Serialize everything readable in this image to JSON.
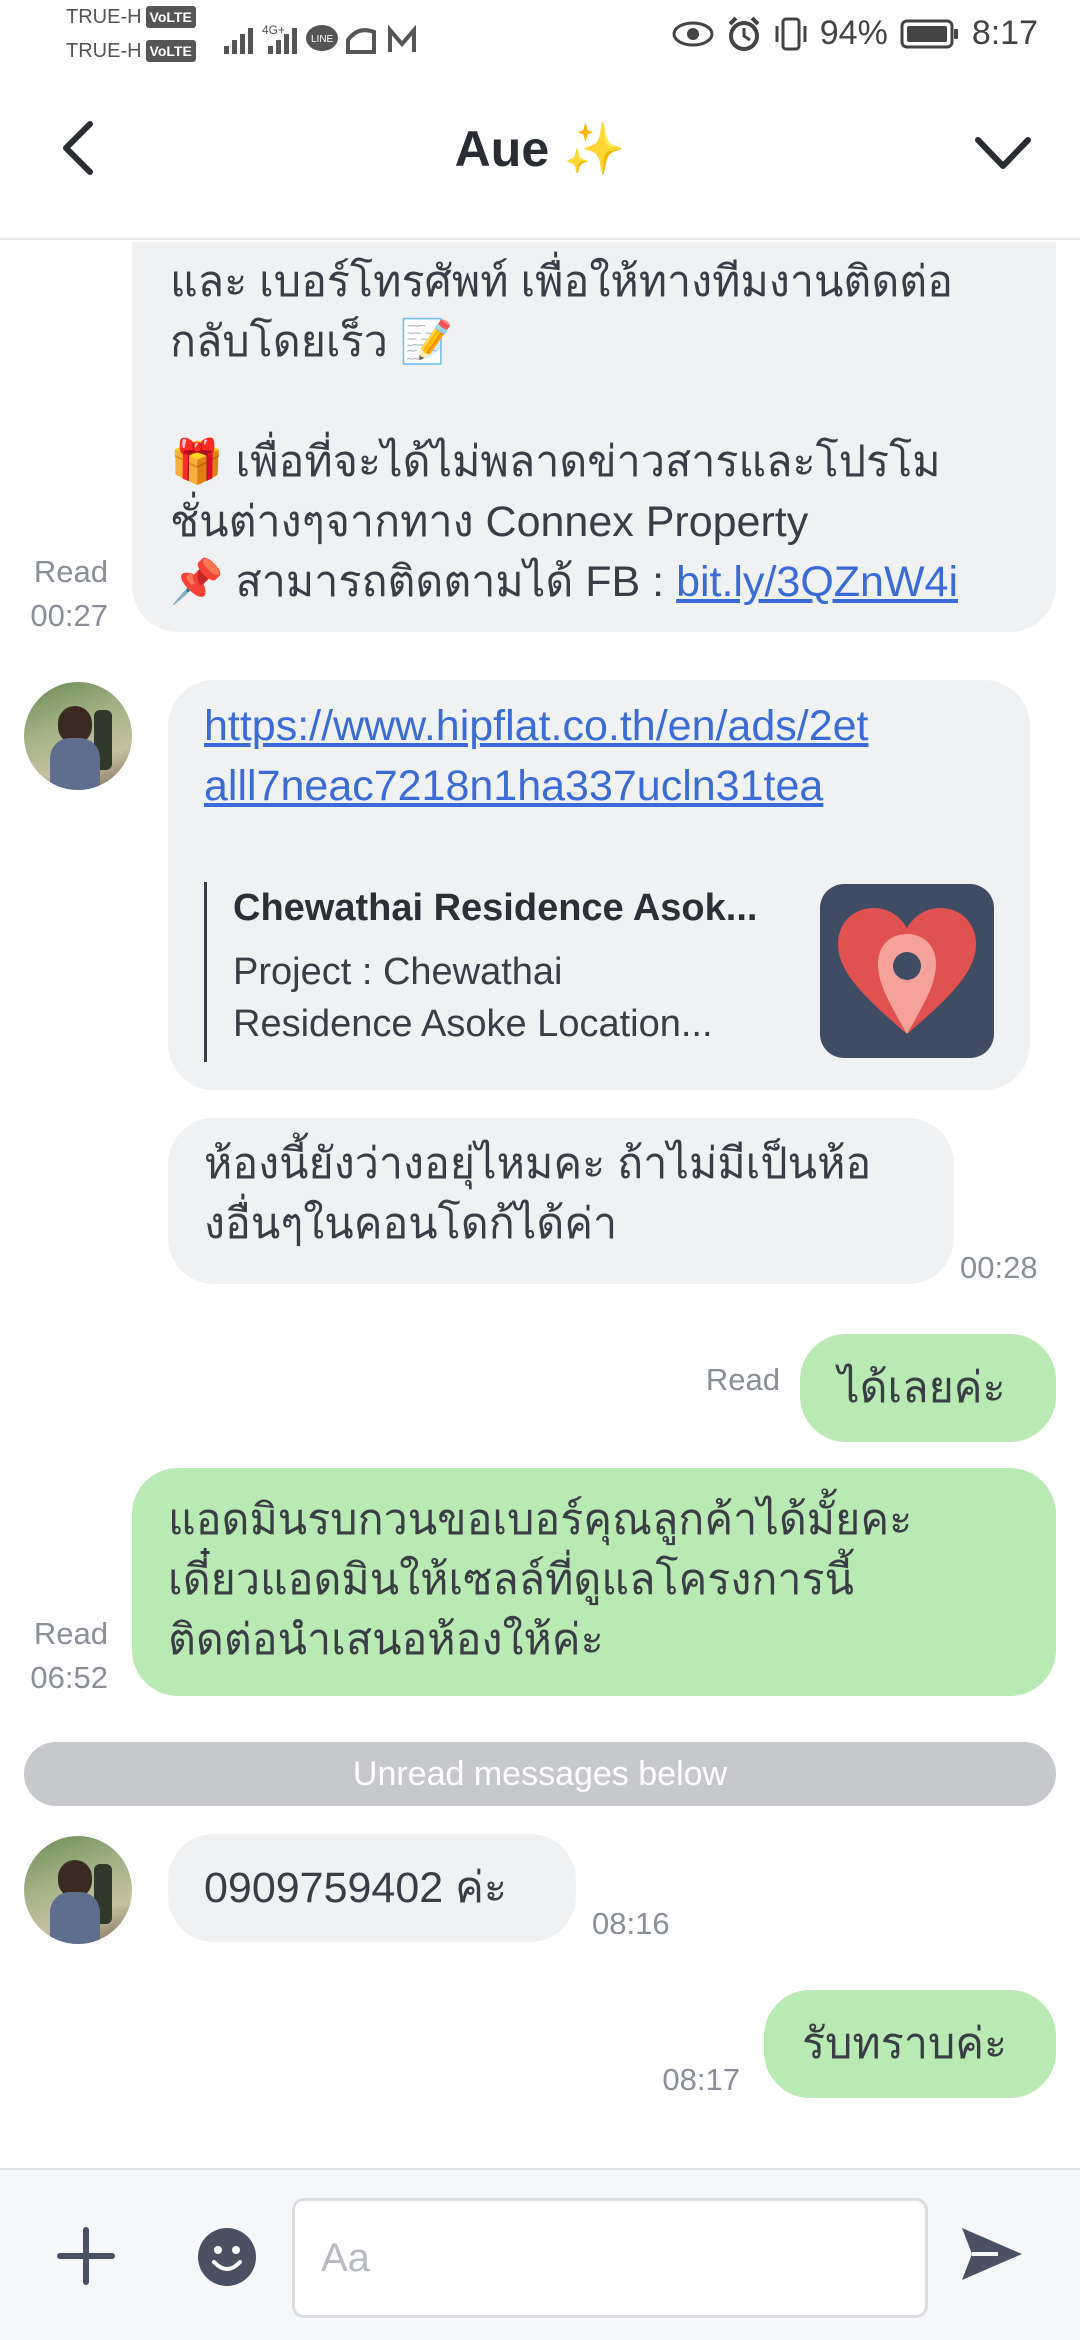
{
  "status_bar": {
    "carrier_1": "TRUE-H",
    "carrier_2": "TRUE-H",
    "volte": "VoLTE",
    "network": "4G+",
    "battery": "94%",
    "time": "8:17"
  },
  "header": {
    "title": "Aue",
    "title_emoji": "✨"
  },
  "messages": {
    "m1": {
      "line1": "และ เบอร์โทรศัพท์ เพื่อให้ทางทีมงานติดต่อ",
      "line2": "กลับโดยเร็ว 📝",
      "line3": "🎁 เพื่อที่จะได้ไม่พลาดข่าวสารและโปรโม",
      "line4": "ชั่นต่างๆจากทาง Connex Property",
      "line5_prefix": "📌 สามารถติดตามได้ FB : ",
      "line5_link": "bit.ly/3QZnW4i",
      "status": "Read",
      "time": "00:27"
    },
    "m2": {
      "link_line1": "https://www.hipflat.co.th/en/ads/2et",
      "link_line2": "alll7neac7218n1ha337ucln31tea",
      "preview_title": "Chewathai Residence Asok...",
      "preview_desc_line1": "Project : Chewathai",
      "preview_desc_line2": "Residence Asoke Location..."
    },
    "m3": {
      "line1": "ห้องนี้ยังว่างอยุ่ไหมคะ ถ้าไม่มีเป็นห้อ",
      "line2": "งอื่นๆในคอนโดก้ได้ค่า",
      "time": "00:28"
    },
    "m4": {
      "text": "ได้เลยค่ะ",
      "status": "Read"
    },
    "m5": {
      "line1": "แอดมินรบกวนขอเบอร์คุณลูกค้าได้มั้ยคะ",
      "line2": "เดี๋ยวแอดมินให้เซลล์ที่ดูแลโครงการนี้",
      "line3": "ติดต่อนำเสนอห้องให้ค่ะ",
      "status": "Read",
      "time": "06:52"
    },
    "divider": "Unread messages below",
    "m6": {
      "text": "0909759402 ค่ะ",
      "time": "08:16"
    },
    "m7": {
      "text": "รับทราบค่ะ",
      "time": "08:17"
    }
  },
  "input": {
    "placeholder": "Aa"
  },
  "colors": {
    "incoming_bubble": "#f0f1f3",
    "outgoing_bubble": "#b9eab3",
    "link": "#3b6bd6"
  }
}
